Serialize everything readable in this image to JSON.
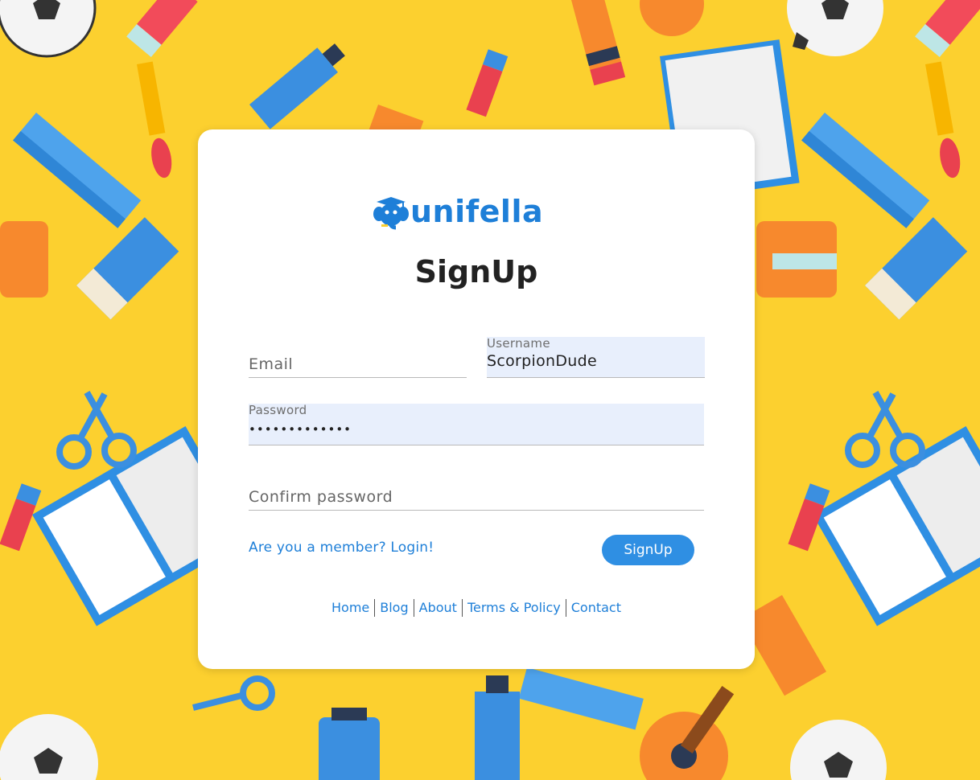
{
  "brand": {
    "name": "unifella",
    "logo_icon": "elephant-graduate-icon",
    "color": "#1e7fd8"
  },
  "form": {
    "title": "SignUp",
    "email": {
      "placeholder": "Email",
      "value": ""
    },
    "username": {
      "label": "Username",
      "value": "ScorpionDude"
    },
    "password": {
      "label": "Password",
      "value": "•••••••••••••"
    },
    "confirm_password": {
      "placeholder": "Confirm password",
      "value": ""
    },
    "member_link": "Are you a member? Login!",
    "submit_label": "SignUp"
  },
  "footer": {
    "links": [
      "Home",
      "Blog",
      "About",
      "Terms & Policy",
      "Contact"
    ]
  },
  "colors": {
    "background": "#fcd02f",
    "accent": "#2f8fe3",
    "field_fill": "#e8effc"
  }
}
